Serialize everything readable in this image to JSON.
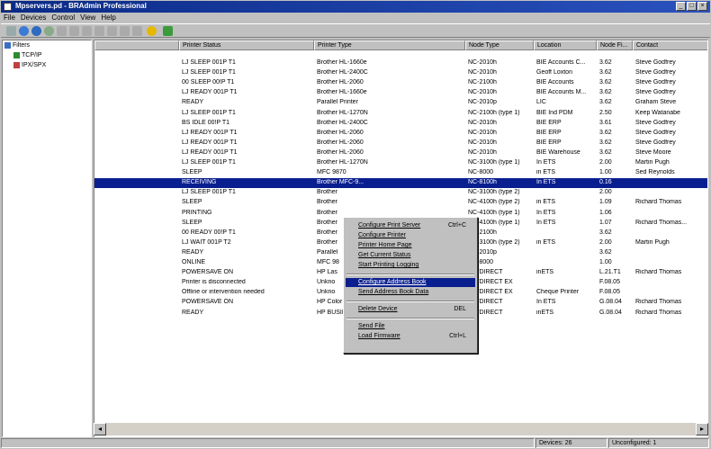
{
  "window": {
    "title": "Mpservers.pd - BRAdmin Professional"
  },
  "menu": [
    "File",
    "Devices",
    "Control",
    "View",
    "Help"
  ],
  "tree": {
    "root": "Filters",
    "items": [
      "TCP/IP",
      "IPX/SPX"
    ]
  },
  "columns": [
    "Printer Status",
    "Printer Type",
    "Node Type",
    "Location",
    "Node Fi...",
    "Contact"
  ],
  "rows": [
    [
      "LJ SLEEP 001P T1",
      "Brother HL-1660e",
      "NC-2010h",
      "BIE Accounts C...",
      "3.62",
      "Steve Godfrey"
    ],
    [
      "LJ SLEEP 001P T1",
      "Brother HL-2400C",
      "NC-2010h",
      "Geoff Loxton",
      "3.62",
      "Steve Godfrey"
    ],
    [
      "00 SLEEP 00!P T1",
      "Brother HL-2060",
      "NC-2100h",
      "BIE Accounts",
      "3.62",
      "Steve Godfrey"
    ],
    [
      "LJ READY 001P T1",
      "Brother HL-1660e",
      "NC-2010h",
      "BIE Accounts M...",
      "3.62",
      "Steve Godfrey"
    ],
    [
      "READY",
      "Parallel Printer",
      "NC-2010p",
      "LIC",
      "3.62",
      "Graham Steve"
    ],
    [
      "LJ SLEEP 001P T1",
      "Brother HL-1270N",
      "NC-2100h (type 1)",
      "BIE Ind PDM",
      "2.50",
      "Keep Watanabe"
    ],
    [
      "BS IDLE 00!P T1",
      "Brother HL-2400C",
      "NC-2010h",
      "BIE ERP",
      "3.61",
      "Steve Godfrey"
    ],
    [
      "LJ READY 001P T1",
      "Brother HL-2060",
      "NC-2010h",
      "BIE ERP",
      "3.62",
      "Steve Godfrey"
    ],
    [
      "LJ READY 001P T1",
      "Brother HL-2060",
      "NC-2010h",
      "BIE ERP",
      "3.62",
      "Steve Godfrey"
    ],
    [
      "LJ READY 001P T1",
      "Brother HL-2060",
      "NC-2010h",
      "BIE Warehouse",
      "3.62",
      "Steve Moore"
    ],
    [
      "LJ SLEEP 001P T1",
      "Brother HL-1270N",
      "NC-3100h (type 1)",
      "In ETS",
      "2.00",
      "Martin Pugh"
    ],
    [
      "SLEEP",
      "MFC 9870",
      "NC-8000",
      "in ETS",
      "1.00",
      "Sed Reynolds"
    ],
    [
      "RECEIVING",
      "Brother MFC-9...",
      "NC-8100h",
      "In ETS",
      "0.16",
      ""
    ],
    [
      "LJ SLEEP 001P T1",
      "Brother",
      "NC-3100h (type 2)",
      "",
      "2.00",
      ""
    ],
    [
      "SLEEP",
      "Brother",
      "NC-4100h (type 2)",
      "in ETS",
      "1.09",
      "Richard Thomas"
    ],
    [
      "PRINTING",
      "Brother",
      "NC-4100h (type 1)",
      "In ETS",
      "1.06",
      ""
    ],
    [
      "SLEEP",
      "Brother",
      "NC-4100h (type 1)",
      "In ETS",
      "1.07",
      "Richard Thomas..."
    ],
    [
      "00 READY 00!P T1",
      "Brother",
      "NC-2100h",
      "",
      "3.62",
      ""
    ],
    [
      "LJ WAIT 001P T2",
      "Brother",
      "NC-3100h (type 2)",
      "in ETS",
      "2.00",
      "Martin Pugh"
    ],
    [
      "READY",
      "Parallel",
      "NC-2010p",
      "",
      "3.62",
      ""
    ],
    [
      "ONLINE",
      "MFC 98",
      "NC-8000",
      "",
      "1.00",
      ""
    ],
    [
      "POWERSAVE ON",
      "HP Las",
      "JETDIRECT",
      "inETS",
      "L.21.T1",
      "Richard Thomas"
    ],
    [
      "Printer is disconnected",
      "Unkno",
      "JETDIRECT EX",
      "",
      "F.08.05",
      ""
    ],
    [
      "Offline or intervention needed",
      "Unkno",
      "JETDIRECT EX",
      "Cheque Printer",
      "F.08.05",
      ""
    ],
    [
      "POWERSAVE ON",
      "HP Color LaserJet 4500",
      "JETDIRECT",
      "In ETS",
      "G.08.04",
      "Richard Thomas"
    ],
    [
      "READY",
      "HP BUSINESS INKJET 2250",
      "JETDIRECT",
      "inETS",
      "G.08.04",
      "Richard Thomas"
    ]
  ],
  "selected_row": 12,
  "context_menu": {
    "items": [
      {
        "label": "Configure Print Server",
        "shortcut": "Ctrl+C"
      },
      {
        "label": "Configure Printer",
        "shortcut": ""
      },
      {
        "label": "Printer Home Page",
        "shortcut": ""
      },
      {
        "label": "Get Current Status",
        "shortcut": ""
      },
      {
        "label": "Start Printing Logging",
        "shortcut": ""
      },
      {
        "sep": true
      },
      {
        "label": "Configure Address Book",
        "shortcut": "",
        "highlight": true
      },
      {
        "label": "Send Address Book Data",
        "shortcut": ""
      },
      {
        "sep": true
      },
      {
        "label": "Delete Device",
        "shortcut": "DEL"
      },
      {
        "sep": true
      },
      {
        "label": "Send File",
        "shortcut": ""
      },
      {
        "label": "Load Firmware",
        "shortcut": "Ctrl+L"
      }
    ]
  },
  "status": {
    "devices": "Devices: 26",
    "unconfigured": "Unconfigured: 1"
  },
  "colors": {
    "title_bar": "#0a2a86",
    "selection": "#0a1f8f",
    "face": "#c0c0c0"
  }
}
